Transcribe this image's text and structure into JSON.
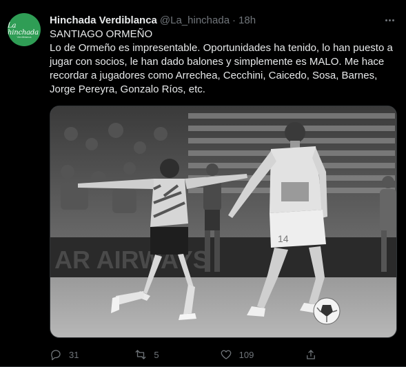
{
  "tweet": {
    "avatar": {
      "text": "La hinchada",
      "sub": "Verdiblanca"
    },
    "author_name": "Hinchada Verdiblanca",
    "handle": "@La_hinchada",
    "separator": "·",
    "time": "18h",
    "text_title": "SANTIAGO ORMEÑO",
    "text_body": "Lo de Ormeño es impresentable. Oportunidades ha tenido, lo han puesto a jugar con socios, le han dado balones y simplemente es MALO. Me hace recordar a jugadores como Arrechea, Cecchini, Caicedo, Sosa, Barnes, Jorge Pereyra, Gonzalo Ríos, etc.",
    "media": {
      "description_icon": "photo-soccer-players",
      "board_text": "AR AIRWAYS",
      "shirt_sponsor": "SOKSO",
      "shirt_number": "14"
    },
    "actions": {
      "replies": "31",
      "retweets": "5",
      "likes": "109"
    }
  },
  "colors": {
    "background": "#000000",
    "text": "#e7e9ea",
    "muted": "#71767b",
    "avatar": "#2f9d55"
  }
}
